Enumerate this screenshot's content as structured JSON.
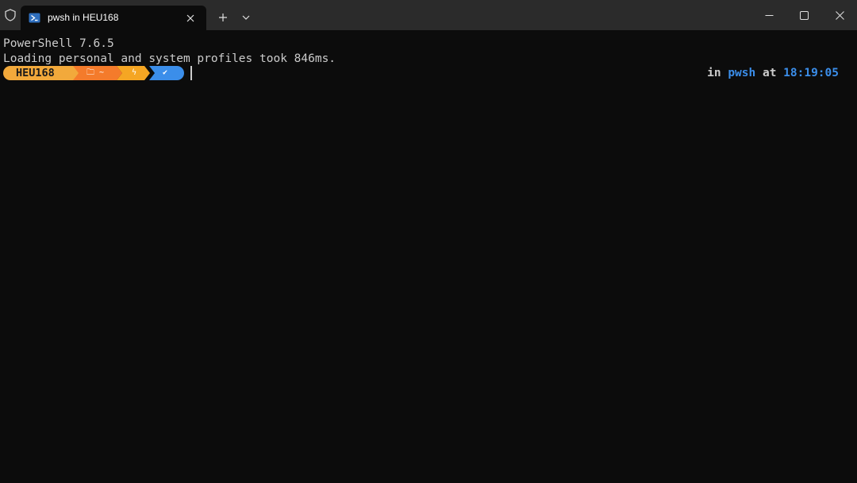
{
  "window": {
    "tab_title": "pwsh in HEU168",
    "icons": {
      "shield": "shield-icon",
      "tab": "powershell-icon",
      "close_tab": "close-icon",
      "new_tab": "plus-icon",
      "dropdown": "chevron-down-icon",
      "minimize": "minimize-icon",
      "maximize": "maximize-icon",
      "close": "close-icon"
    }
  },
  "terminal": {
    "lines": [
      "PowerShell 7.6.5",
      "Loading personal and system profiles took 846ms."
    ],
    "prompt": {
      "host": "HEU168",
      "path_glyph": "🗀 ~",
      "git_glyph": "ϟ",
      "status_glyph": "✔"
    },
    "right_prompt": {
      "in_label": "in ",
      "shell": "pwsh",
      "at_label": " at ",
      "time": "18:19:05"
    }
  },
  "colors": {
    "background": "#0c0c0c",
    "titlebar": "#2b2b2b",
    "host_segment": "#f2a93b",
    "path_segment": "#f47b2b",
    "git_segment": "#f5a623",
    "status_segment": "#3b8eea",
    "accent_blue": "#3b8eea"
  }
}
